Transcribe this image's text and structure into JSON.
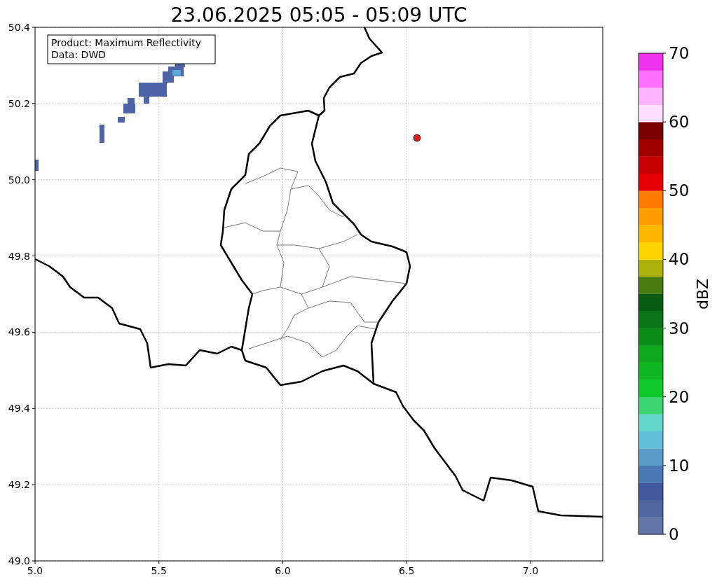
{
  "title": "23.06.2025 05:05 - 05:09 UTC",
  "info_box": {
    "lines": [
      "Product: Maximum Reflectivity",
      "Data: DWD"
    ]
  },
  "map": {
    "x_ticks": [
      "5.0",
      "5.5",
      "6.0",
      "6.5",
      "7.0"
    ],
    "y_ticks": [
      "50.4",
      "50.2",
      "50.0",
      "49.8",
      "49.6",
      "49.4",
      "49.2",
      "49.0"
    ]
  },
  "colorbar": {
    "label": "dBZ",
    "ticks": [
      "70",
      "60",
      "50",
      "40",
      "30",
      "20",
      "10",
      "0"
    ],
    "segments": [
      {
        "color": "#6577a9"
      },
      {
        "color": "#52669f"
      },
      {
        "color": "#4259a0"
      },
      {
        "color": "#4a7ab4"
      },
      {
        "color": "#5a9cc8"
      },
      {
        "color": "#62bfdc"
      },
      {
        "color": "#62d6c8"
      },
      {
        "color": "#3cd470"
      },
      {
        "color": "#11c92a"
      },
      {
        "color": "#0fb820"
      },
      {
        "color": "#0ea81c"
      },
      {
        "color": "#0b8c18"
      },
      {
        "color": "#0a7517"
      },
      {
        "color": "#085c12"
      },
      {
        "color": "#4a7a10"
      },
      {
        "color": "#adb10a"
      },
      {
        "color": "#fdd600"
      },
      {
        "color": "#ffb700"
      },
      {
        "color": "#ff9e00"
      },
      {
        "color": "#ff7c00"
      },
      {
        "color": "#e40000"
      },
      {
        "color": "#c40000"
      },
      {
        "color": "#a00000"
      },
      {
        "color": "#7a0000"
      },
      {
        "color": "#ffe0ff"
      },
      {
        "color": "#ffb4ff"
      },
      {
        "color": "#ff70ff"
      },
      {
        "color": "#ee33ee"
      }
    ]
  }
}
